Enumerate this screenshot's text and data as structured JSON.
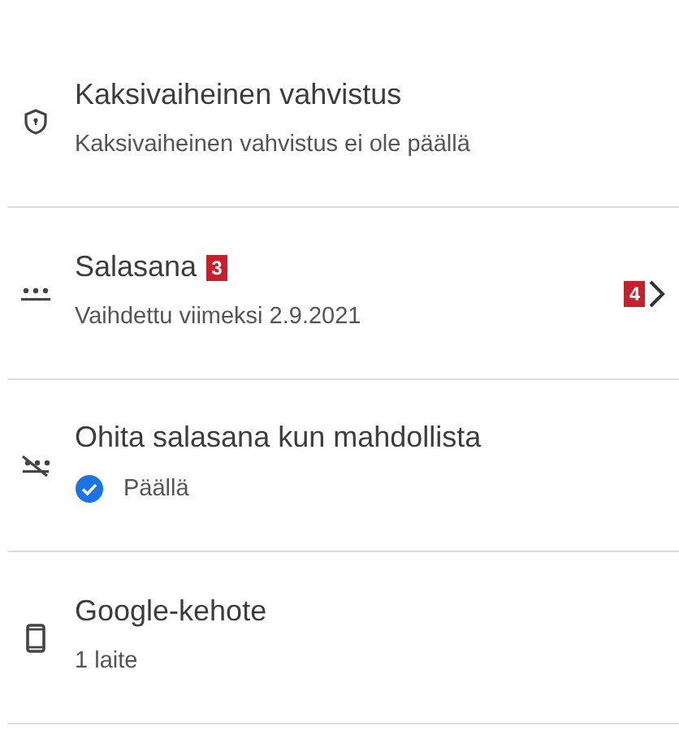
{
  "items": [
    {
      "title": "Kaksivaiheinen vahvistus",
      "subtitle": "Kaksivaiheinen vahvistus ei ole päällä"
    },
    {
      "title": "Salasana",
      "title_badge": "3",
      "subtitle": "Vaihdettu viimeksi 2.9.2021",
      "chevron_badge": "4",
      "chevron": true
    },
    {
      "title": "Ohita salasana kun mahdollista",
      "status": {
        "text": "Päällä",
        "checked": true
      }
    },
    {
      "title": "Google-kehote",
      "subtitle": "1 laite"
    }
  ]
}
